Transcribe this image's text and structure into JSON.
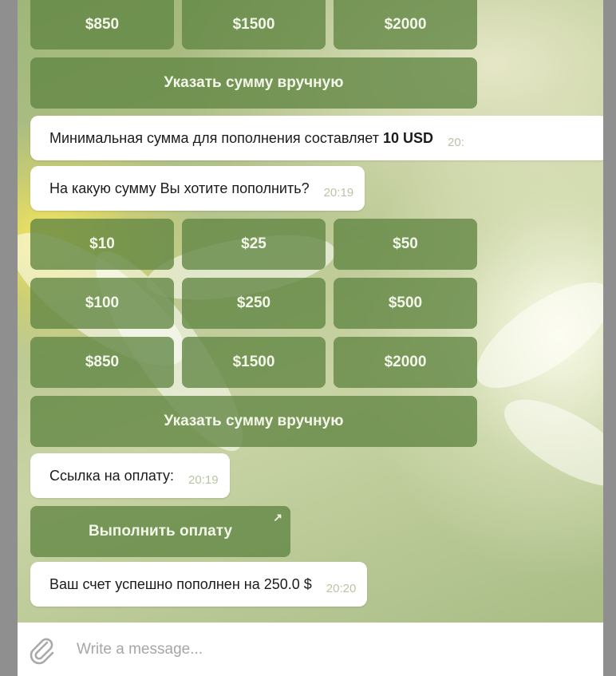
{
  "keyboard_top": {
    "row3": [
      "$850",
      "$1500",
      "$2000"
    ],
    "manual_label": "Указать сумму вручную"
  },
  "messages": {
    "min_amount_text": "Минимальная сумма для пополнения составляет",
    "min_amount_value": "10 USD",
    "min_amount_time": "20:",
    "question_text": "На какую сумму Вы хотите пополнить?",
    "question_time": "20:19",
    "payment_link_text": "Ссылка на оплату:",
    "payment_link_time": "20:19",
    "success_text": "Ваш счет успешно пополнен на 250.0 $",
    "success_time": "20:20"
  },
  "keyboard_main": {
    "row1": [
      "$10",
      "$25",
      "$50"
    ],
    "row2": [
      "$100",
      "$250",
      "$500"
    ],
    "row3": [
      "$850",
      "$1500",
      "$2000"
    ],
    "manual_label": "Указать сумму вручную"
  },
  "pay_button": {
    "label": "Выполнить оплату",
    "arrow": "↗"
  },
  "composer": {
    "placeholder": "Write a message...",
    "attach_icon": "paperclip-icon"
  },
  "colors": {
    "button_bg": "#60854280",
    "bubble_bg": "#ffffff",
    "time_text": "#b9c4a6"
  }
}
